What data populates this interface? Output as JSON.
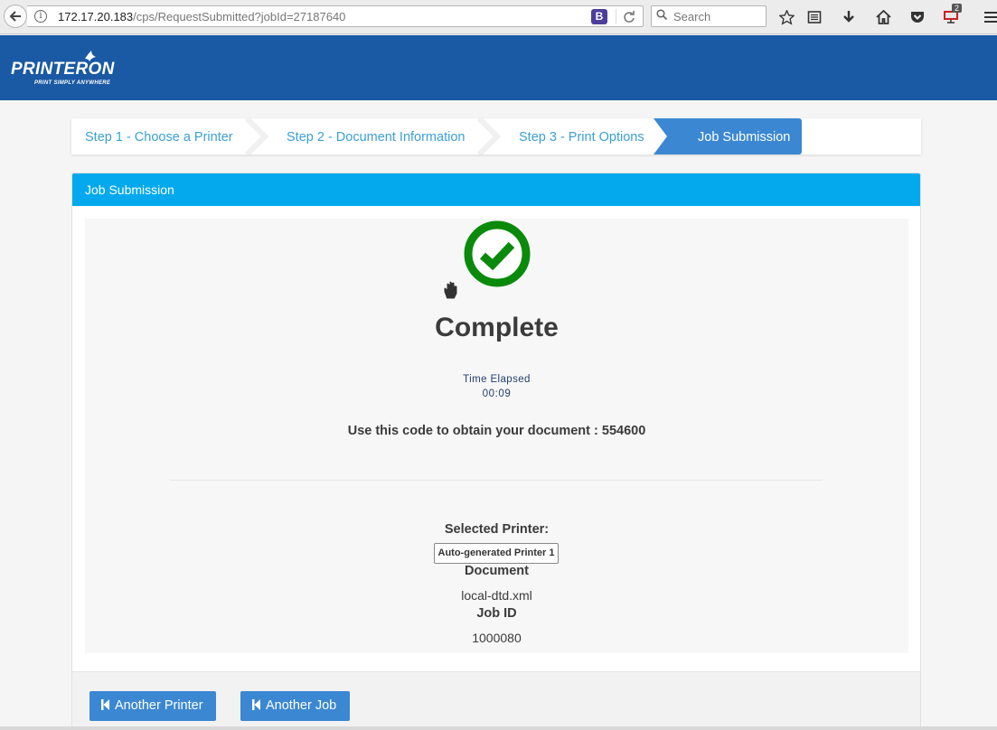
{
  "browser": {
    "url_host": "172.17.20.183",
    "url_path": "/cps/RequestSubmitted?jobId=27187640",
    "search_placeholder": "Search",
    "bitwarden_label": "B",
    "notification_count": "2"
  },
  "header": {
    "logo_text": "PRINTERON",
    "logo_tagline": "PRINT SIMPLY ANYWHERE"
  },
  "steps": [
    {
      "label": "Step 1 - Choose a Printer"
    },
    {
      "label": "Step 2 - Document Information"
    },
    {
      "label": "Step 3 - Print Options"
    },
    {
      "label": "Job Submission",
      "active": true
    }
  ],
  "panel": {
    "title": "Job Submission",
    "status": "Complete",
    "time_elapsed_label": "Time Elapsed",
    "time_elapsed_value": "00:09",
    "code_line": "Use this code to obtain your document : 554600",
    "selected_printer_label": "Selected Printer:",
    "selected_printer_value": "Auto-generated Printer 1",
    "document_label": "Document",
    "document_value": "local-dtd.xml",
    "job_id_label": "Job ID",
    "job_id_value": "1000080"
  },
  "buttons": {
    "another_printer": "Another Printer",
    "another_job": "Another Job"
  },
  "colors": {
    "header_bg": "#1a59a4",
    "panel_head_bg": "#03a9ec",
    "button_bg": "#3b87d2",
    "success_green": "#0a8a0a",
    "step_text": "#3ba0d6"
  }
}
